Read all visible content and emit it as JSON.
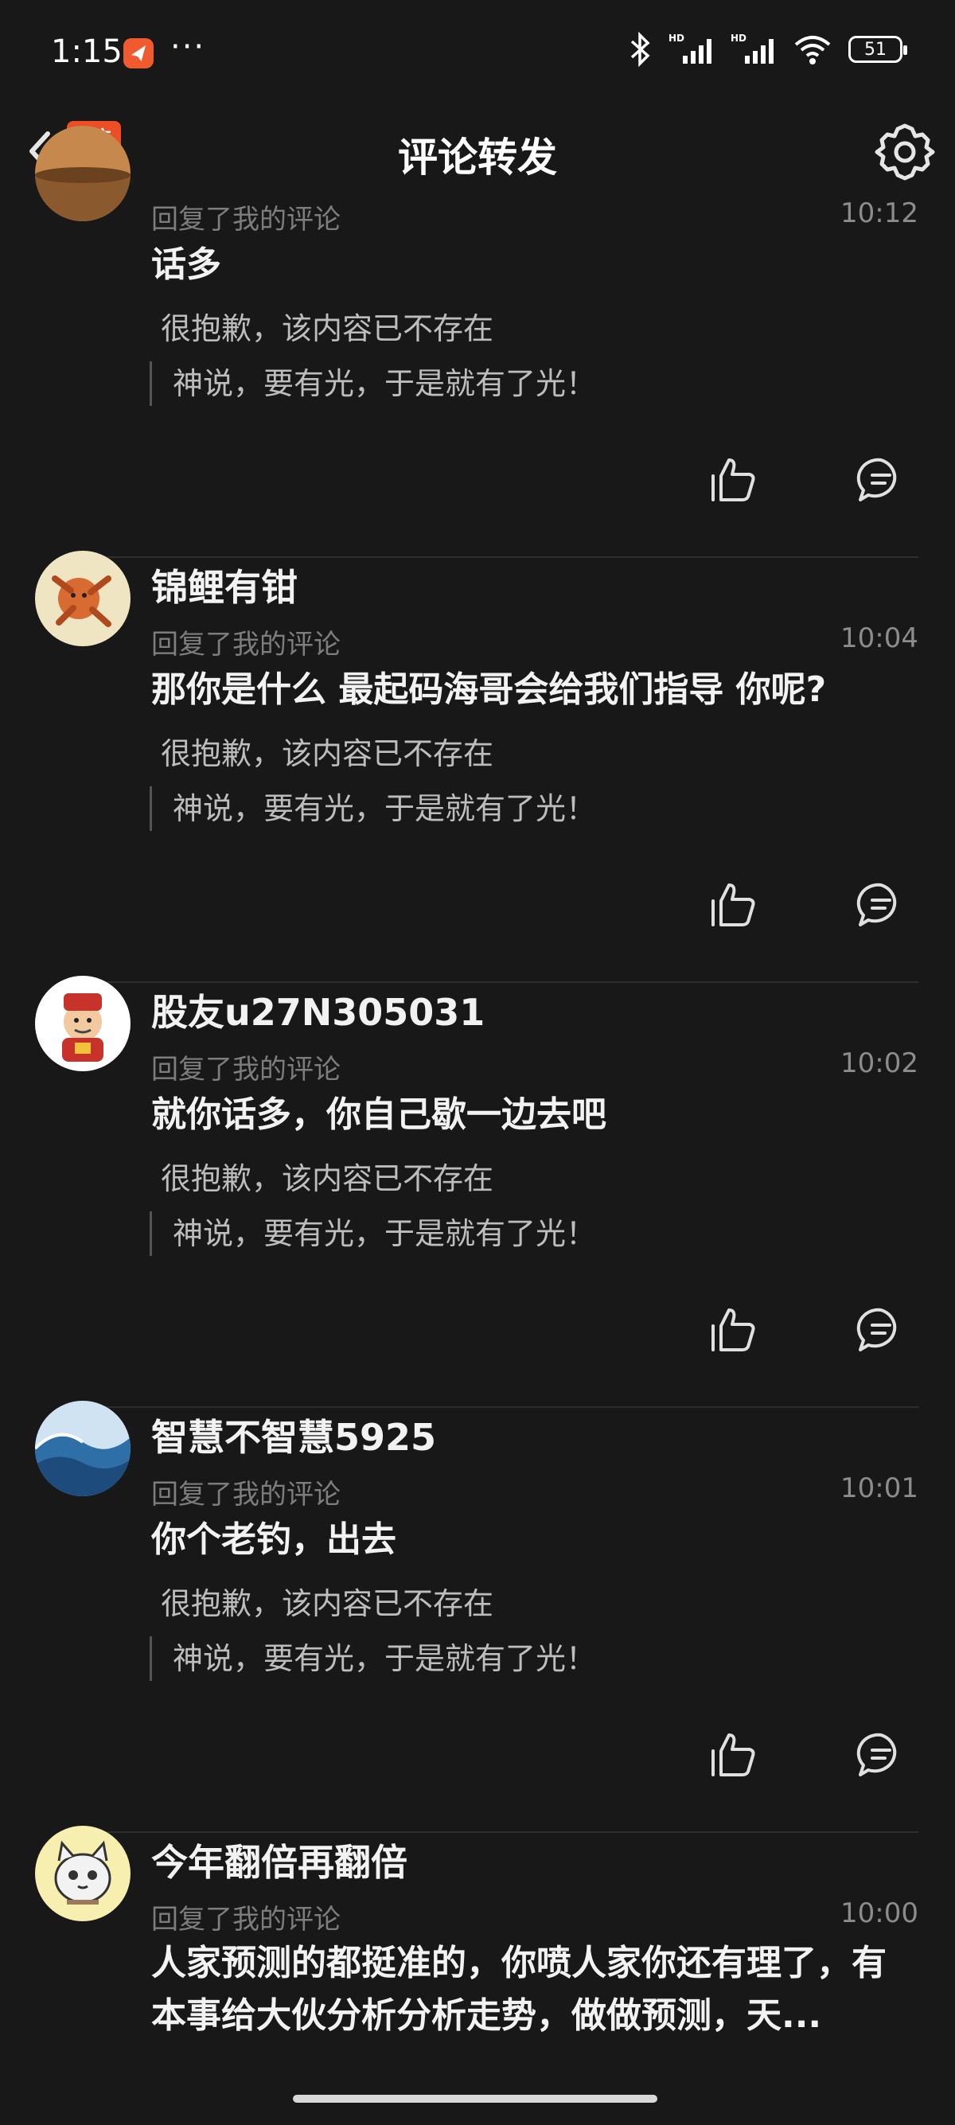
{
  "status_bar": {
    "time": "1:15",
    "more": "···",
    "battery": "51"
  },
  "header": {
    "title": "评论转发",
    "logo_line1": "东方",
    "logo_line2": "财富"
  },
  "comments": [
    {
      "name": "",
      "action": "回复了我的评论",
      "time": "10:12",
      "text": "话多",
      "original": "很抱歉，该内容已不存在",
      "quote": "神说，要有光，于是就有了光！"
    },
    {
      "name": "锦鲤有钳",
      "action": "回复了我的评论",
      "time": "10:04",
      "text": "那你是什么 最起码海哥会给我们指导 你呢?",
      "original": "很抱歉，该内容已不存在",
      "quote": "神说，要有光，于是就有了光！"
    },
    {
      "name": "股友u27N305031",
      "action": "回复了我的评论",
      "time": "10:02",
      "text": "就你话多，你自己歇一边去吧",
      "original": "很抱歉，该内容已不存在",
      "quote": "神说，要有光，于是就有了光！"
    },
    {
      "name": "智慧不智慧5925",
      "action": "回复了我的评论",
      "time": "10:01",
      "text": "你个老钓，出去",
      "original": "很抱歉，该内容已不存在",
      "quote": "神说，要有光，于是就有了光！"
    },
    {
      "name": "今年翻倍再翻倍",
      "action": "回复了我的评论",
      "time": "10:00",
      "text": "人家预测的都挺准的，你喷人家你还有理了，有本事给大伙分析分析走势，做做预测，天...",
      "original": "",
      "quote": ""
    }
  ],
  "colors": {
    "background": "#181818",
    "accent": "#ec4f25",
    "text": "#f2f2f2",
    "muted": "#7d7d7d"
  }
}
